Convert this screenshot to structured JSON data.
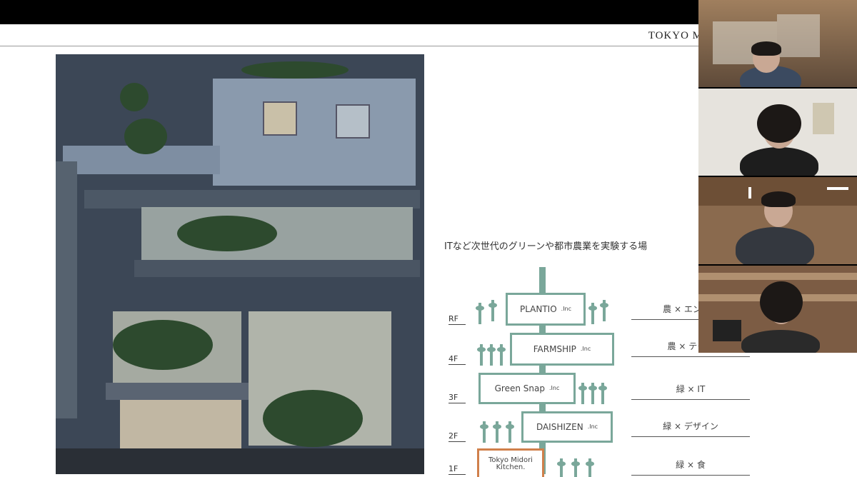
{
  "slide": {
    "title": "TOKYO M",
    "caption": "ITなど次世代のグリーンや都市農業を実験する場",
    "floors": [
      {
        "label": "RF",
        "company": "PLANTIO",
        "suffix": ".Inc",
        "tag": "農 × エンター"
      },
      {
        "label": "4F",
        "company": "FARMSHIP",
        "suffix": ".Inc",
        "tag": "農 × テクノ"
      },
      {
        "label": "3F",
        "company": "Green Snap",
        "suffix": ".Inc",
        "tag": "緑 × IT"
      },
      {
        "label": "2F",
        "company": "DAISHIZEN",
        "suffix": ".Inc",
        "tag": "緑 × デザイン"
      },
      {
        "label": "1F",
        "company": "Tokyo Midori Kitchen.",
        "suffix": "",
        "tag": "緑 × 食"
      }
    ]
  },
  "video": {
    "participants": 4
  },
  "colors": {
    "accent": "#7aa79a",
    "kitchen_border": "#d0804b"
  }
}
